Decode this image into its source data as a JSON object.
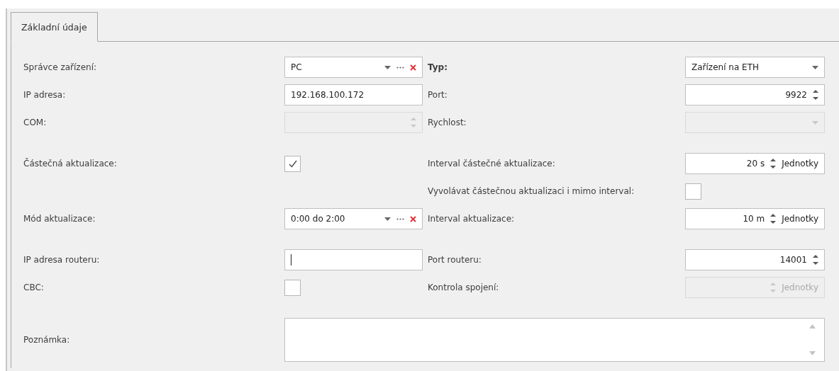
{
  "tabs": [
    {
      "label": "Základní údaje",
      "selected": true
    }
  ],
  "groups": [
    {
      "rows": [
        {
          "left": {
            "label": "Správce zařízení:",
            "field": {
              "kind": "lookup",
              "value": "PC"
            }
          },
          "right": {
            "label": "Typ:",
            "bold": true,
            "field": {
              "kind": "combo",
              "value": "Zařízení na ETH",
              "disabled": false
            }
          }
        },
        {
          "left": {
            "label": "IP adresa:",
            "field": {
              "kind": "text",
              "value": "192.168.100.172",
              "focused": false
            }
          },
          "right": {
            "label": "Port:",
            "field": {
              "kind": "spin",
              "value": "9922",
              "disabled": false
            }
          }
        },
        {
          "left": {
            "label": "COM:",
            "field": {
              "kind": "spin",
              "disabled": true
            }
          },
          "right": {
            "label": "Rychlost:",
            "field": {
              "kind": "combo",
              "disabled": true
            }
          }
        }
      ]
    },
    {
      "rows": [
        {
          "left": {
            "label": "Částečná aktualizace:",
            "field": {
              "kind": "checkbox",
              "checked": true
            }
          },
          "right": {
            "label": "Interval částečné aktualizace:",
            "field": {
              "kind": "spin",
              "value": "20 s",
              "unit": "Jednotky",
              "disabled": false
            }
          }
        },
        {
          "right": {
            "label": "Vyvolávat částečnou aktualizaci i mimo interval:",
            "field": {
              "kind": "checkbox",
              "checked": false
            }
          }
        },
        {
          "left": {
            "label": "Mód aktualizace:",
            "field": {
              "kind": "lookup",
              "value": "0:00 do 2:00"
            }
          },
          "right": {
            "label": "Interval aktualizace:",
            "field": {
              "kind": "spin",
              "value": "10 m",
              "unit": "Jednotky",
              "disabled": false
            }
          }
        }
      ]
    },
    {
      "rows": [
        {
          "left": {
            "label": "IP adresa routeru:",
            "field": {
              "kind": "text",
              "focused": true
            }
          },
          "right": {
            "label": "Port routeru:",
            "field": {
              "kind": "spin",
              "value": "14001",
              "disabled": false
            }
          }
        },
        {
          "left": {
            "label": "CBC:",
            "field": {
              "kind": "checkbox",
              "checked": false
            }
          },
          "right": {
            "label": "Kontrola spojení:",
            "field": {
              "kind": "spin",
              "unit": "Jednotky",
              "disabled": true
            }
          }
        }
      ]
    },
    {
      "rows": [
        {
          "left": {
            "label": "Poznámka:",
            "field": {
              "kind": "memo"
            }
          },
          "wide": true
        }
      ]
    }
  ]
}
